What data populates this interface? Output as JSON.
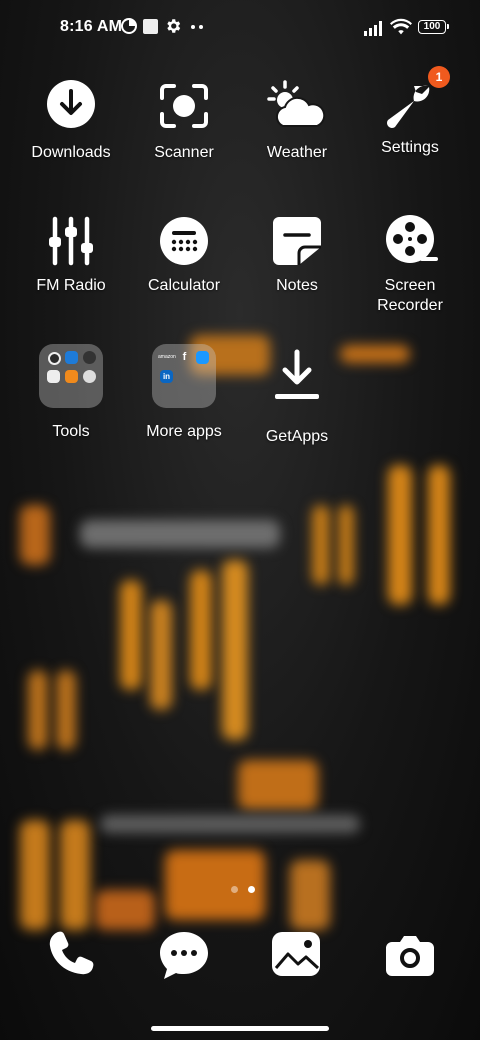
{
  "status_bar": {
    "time": "8:16 AM",
    "battery": "100",
    "icons": [
      "data-saver-icon",
      "notification-square-icon",
      "settings-gear-icon",
      "more-dots-icon",
      "signal-icon",
      "wifi-icon",
      "battery-icon"
    ]
  },
  "apps": {
    "downloads": {
      "label": "Downloads",
      "icon": "download-icon"
    },
    "scanner": {
      "label": "Scanner",
      "icon": "scanner-icon"
    },
    "weather": {
      "label": "Weather",
      "icon": "weather-icon"
    },
    "settings": {
      "label": "Settings",
      "icon": "wrench-icon",
      "badge": "1"
    },
    "fm_radio": {
      "label": "FM Radio",
      "icon": "equalizer-icon"
    },
    "calculator": {
      "label": "Calculator",
      "icon": "calculator-icon"
    },
    "notes": {
      "label": "Notes",
      "icon": "notes-icon"
    },
    "screen_recorder": {
      "label": "Screen Recorder",
      "icon": "film-reel-icon"
    },
    "tools": {
      "label": "Tools",
      "icon": "folder-icon"
    },
    "more_apps": {
      "label": "More apps",
      "icon": "folder-icon"
    },
    "getapps": {
      "label": "GetApps",
      "icon": "download-tray-icon"
    }
  },
  "folder_tiles": {
    "more_apps_mini": {
      "amazon": "amazon",
      "facebook": "f",
      "linkedin": "in"
    }
  },
  "page_indicator": {
    "pages": 2,
    "active": 2
  },
  "dock": [
    "phone-icon",
    "messages-icon",
    "gallery-icon",
    "camera-icon"
  ],
  "colors": {
    "badge": "#f05a1e",
    "text": "#ffffff",
    "accent_wallpaper": "#e08a1c"
  }
}
